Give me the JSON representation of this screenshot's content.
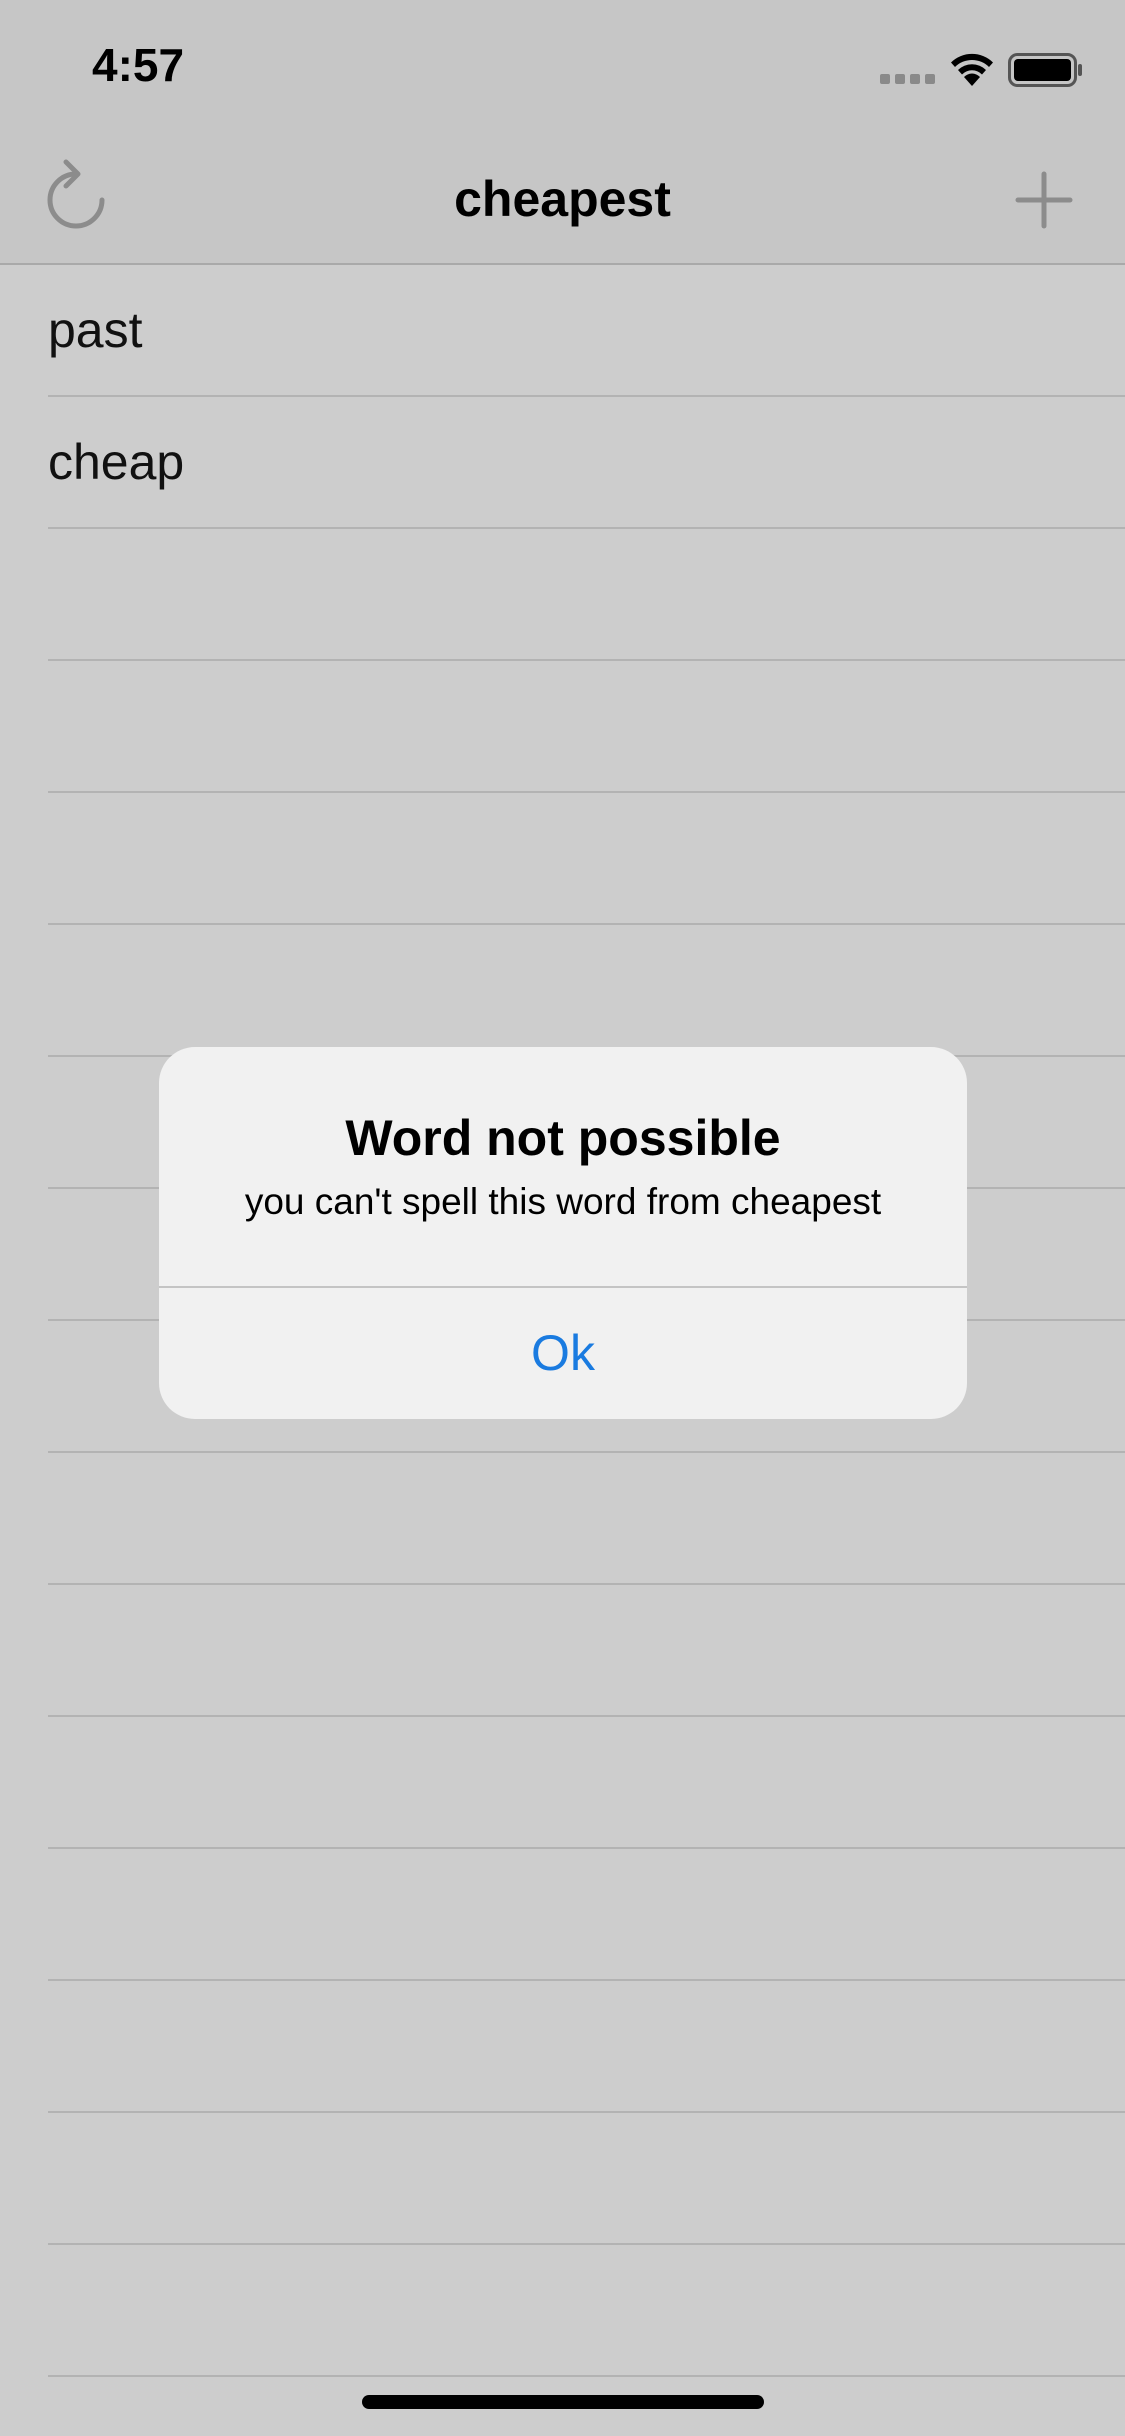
{
  "status_bar": {
    "time": "4:57",
    "icons": [
      "cellular-signal-icon",
      "wifi-icon",
      "battery-icon"
    ]
  },
  "nav_bar": {
    "title": "cheapest",
    "left_icon": "refresh-icon",
    "right_icon": "plus-icon"
  },
  "word_list": {
    "items": [
      {
        "label": "past"
      },
      {
        "label": "cheap"
      },
      {
        "label": ""
      },
      {
        "label": ""
      },
      {
        "label": ""
      },
      {
        "label": ""
      },
      {
        "label": ""
      },
      {
        "label": ""
      },
      {
        "label": ""
      },
      {
        "label": ""
      },
      {
        "label": ""
      },
      {
        "label": ""
      },
      {
        "label": ""
      },
      {
        "label": ""
      },
      {
        "label": ""
      },
      {
        "label": ""
      }
    ]
  },
  "alert": {
    "title": "Word not possible",
    "message": "you can't spell this word from cheapest",
    "ok_label": "Ok"
  },
  "colors": {
    "accent": "#1a7be0",
    "background": "#cdcdcd",
    "bar_background": "#c6c6c6",
    "alert_background": "#f1f1f1"
  }
}
